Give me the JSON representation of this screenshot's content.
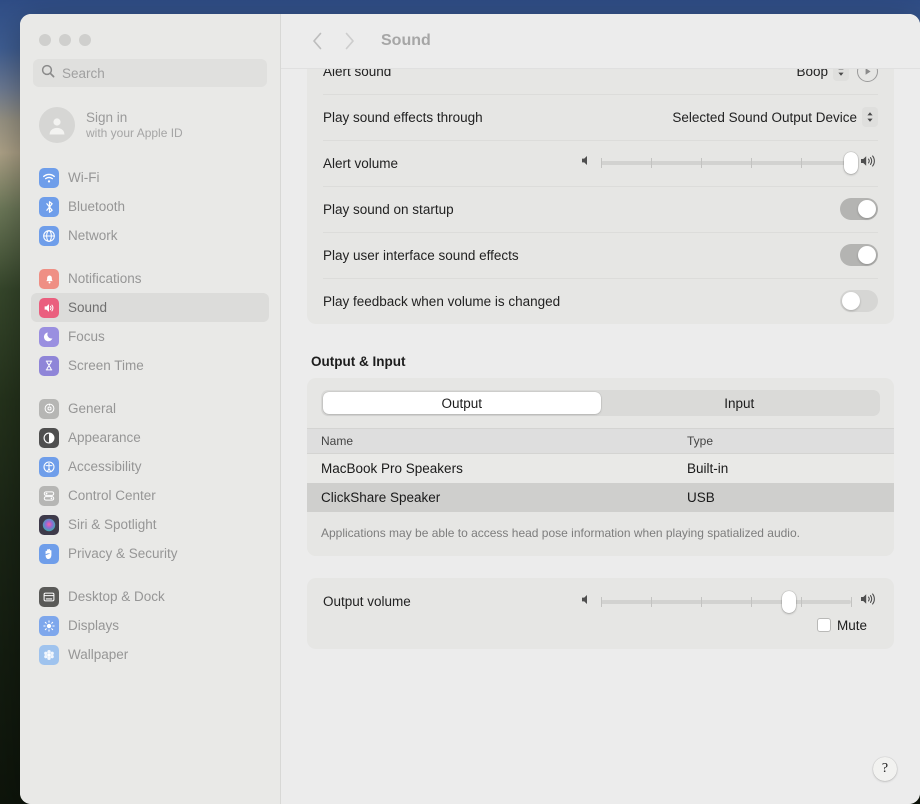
{
  "window": {
    "traffic_lights": [
      "close",
      "minimize",
      "zoom"
    ]
  },
  "sidebar": {
    "search": {
      "placeholder": "Search",
      "value": ""
    },
    "account": {
      "name": "Sign in",
      "sub": "with your Apple ID"
    },
    "groups": [
      {
        "items": [
          {
            "label": "Wi-Fi",
            "icon": "wifi-icon",
            "color": "#6f9eea",
            "selected": false
          },
          {
            "label": "Bluetooth",
            "icon": "bluetooth-icon",
            "color": "#6f9eea",
            "selected": false
          },
          {
            "label": "Network",
            "icon": "globe-icon",
            "color": "#6f9eea",
            "selected": false
          }
        ]
      },
      {
        "items": [
          {
            "label": "Notifications",
            "icon": "bell-icon",
            "color": "#ef8f84",
            "selected": false
          },
          {
            "label": "Sound",
            "icon": "speaker-icon",
            "color": "#ea5f7e",
            "selected": true
          },
          {
            "label": "Focus",
            "icon": "moon-icon",
            "color": "#9a8fe0",
            "selected": false
          },
          {
            "label": "Screen Time",
            "icon": "hourglass-icon",
            "color": "#8f85d8",
            "selected": false
          }
        ]
      },
      {
        "items": [
          {
            "label": "General",
            "icon": "gear-icon",
            "color": "#b6b6b4",
            "selected": false
          },
          {
            "label": "Appearance",
            "icon": "appearance-icon",
            "color": "#4f4f4f",
            "selected": false
          },
          {
            "label": "Accessibility",
            "icon": "accessibility-icon",
            "color": "#6f9eea",
            "selected": false
          },
          {
            "label": "Control Center",
            "icon": "control-center-icon",
            "color": "#b6b6b4",
            "selected": false
          },
          {
            "label": "Siri & Spotlight",
            "icon": "siri-icon",
            "color": "#6a5d86",
            "selected": false
          },
          {
            "label": "Privacy & Security",
            "icon": "hand-icon",
            "color": "#6f9eea",
            "selected": false
          }
        ]
      },
      {
        "items": [
          {
            "label": "Desktop & Dock",
            "icon": "desktop-dock-icon",
            "color": "#5a5a58",
            "selected": false
          },
          {
            "label": "Displays",
            "icon": "brightness-icon",
            "color": "#7ea7ec",
            "selected": false
          },
          {
            "label": "Wallpaper",
            "icon": "wallpaper-icon",
            "color": "#9fc3ee",
            "selected": false
          }
        ]
      }
    ]
  },
  "header": {
    "back_label": "‹",
    "forward_label": "›",
    "title": "Sound"
  },
  "main": {
    "alert_group": {
      "alert_sound": {
        "label": "Alert sound",
        "value": "Boop",
        "play_button": "play-sound-button"
      },
      "effects_through": {
        "label": "Play sound effects through",
        "value": "Selected Sound Output Device"
      },
      "alert_volume": {
        "label": "Alert volume",
        "percent": 100,
        "ticks": 6
      },
      "toggles": [
        {
          "label": "Play sound on startup",
          "on": true
        },
        {
          "label": "Play user interface sound effects",
          "on": true
        },
        {
          "label": "Play feedback when volume is changed",
          "on": false
        }
      ]
    },
    "output_input": {
      "heading": "Output & Input",
      "tabs": [
        {
          "label": "Output",
          "active": true
        },
        {
          "label": "Input",
          "active": false
        }
      ],
      "columns": [
        "Name",
        "Type"
      ],
      "rows": [
        {
          "name": "MacBook Pro Speakers",
          "type": "Built-in",
          "selected": false
        },
        {
          "name": "ClickShare Speaker",
          "type": "USB",
          "selected": true
        }
      ],
      "note": "Applications may be able to access head pose information when playing spatialized audio."
    },
    "output_volume": {
      "label": "Output volume",
      "percent": 75,
      "ticks": 6,
      "mute": {
        "label": "Mute",
        "checked": false
      }
    },
    "help_label": "?"
  }
}
